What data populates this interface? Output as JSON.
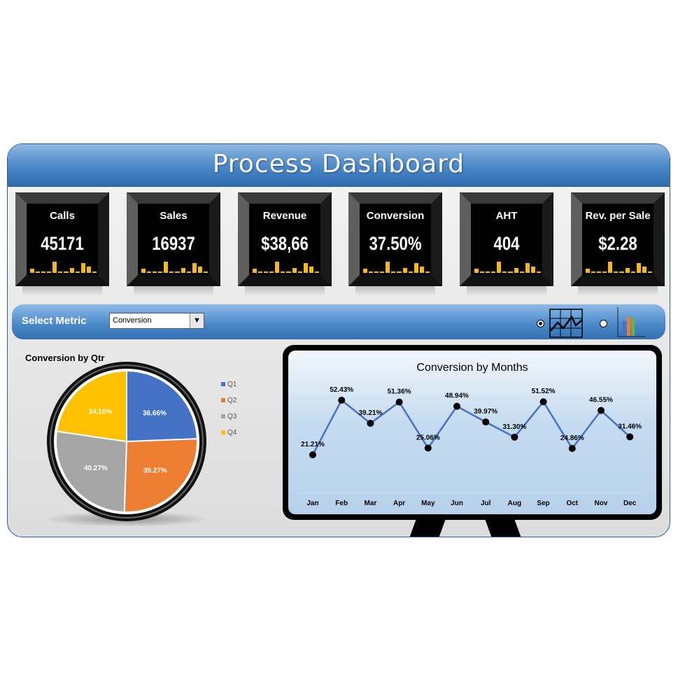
{
  "header": {
    "title": "Process Dashboard"
  },
  "kpis": [
    {
      "label": "Calls",
      "value": "45171"
    },
    {
      "label": "Sales",
      "value": "16937"
    },
    {
      "label": "Revenue",
      "value": "$38,66"
    },
    {
      "label": "Conversion",
      "value": "37.50%"
    },
    {
      "label": "AHT",
      "value": "404"
    },
    {
      "label": "Rev. per Sale",
      "value": "$2.28"
    }
  ],
  "sparkline": [
    5,
    1,
    1,
    1,
    15,
    1,
    1,
    6,
    1,
    13,
    8,
    1
  ],
  "spark_color": "#f2b81e",
  "controls": {
    "select_label": "Select Metric",
    "selected_metric": "Conversion",
    "chart_type_selected": "line",
    "chart_type_options": [
      "line-chart-icon",
      "bar-chart-icon"
    ]
  },
  "chart_data": [
    {
      "type": "pie",
      "title": "Conversion by Qtr",
      "categories": [
        "Q1",
        "Q2",
        "Q3",
        "Q4"
      ],
      "values": [
        36.66,
        39.27,
        40.27,
        34.1
      ],
      "labels": [
        "36.66%",
        "39.27%",
        "40.27%",
        "34.10%"
      ],
      "colors": [
        "#4472c4",
        "#ed7d31",
        "#a5a5a5",
        "#ffc000"
      ],
      "legend": "right"
    },
    {
      "type": "line",
      "title": "Conversion by Months",
      "categories": [
        "Jan",
        "Feb",
        "Mar",
        "Apr",
        "May",
        "Jun",
        "Jul",
        "Aug",
        "Sep",
        "Oct",
        "Nov",
        "Dec"
      ],
      "values": [
        21.21,
        52.43,
        39.21,
        51.36,
        25.06,
        48.94,
        39.97,
        31.3,
        51.52,
        24.86,
        46.55,
        31.46
      ],
      "labels": [
        "21.21%",
        "52.43%",
        "39.21%",
        "51.36%",
        "25.06%",
        "48.94%",
        "39.97%",
        "31.30%",
        "51.52%",
        "24.86%",
        "46.55%",
        "31.46%"
      ],
      "color": "#4472c4",
      "grid": false
    }
  ]
}
